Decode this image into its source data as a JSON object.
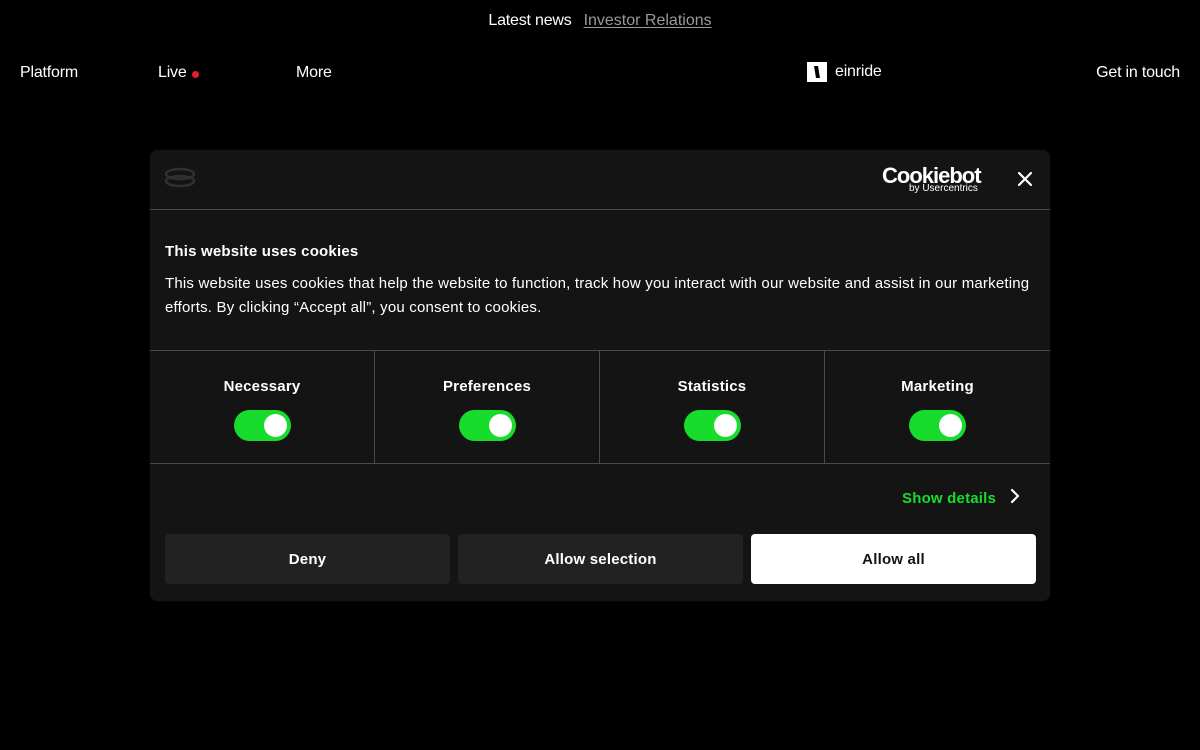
{
  "topbar": {
    "latest_news": "Latest news",
    "investor_relations": "Investor Relations"
  },
  "nav": {
    "platform": "Platform",
    "live": "Live",
    "more": "More",
    "brand": "einride",
    "get_in_touch": "Get in touch",
    "live_dot_color": "#e4202a"
  },
  "cookie_dialog": {
    "provider_name": "Cookiebot",
    "provider_sub": "by Usercentrics",
    "title": "This website uses cookies",
    "text": "This website uses cookies that help the website to function, track how you interact with our website and assist in our marketing efforts. By clicking “Accept all”, you consent to cookies.",
    "categories": [
      {
        "label": "Necessary",
        "enabled": true
      },
      {
        "label": "Preferences",
        "enabled": true
      },
      {
        "label": "Statistics",
        "enabled": true
      },
      {
        "label": "Marketing",
        "enabled": true
      }
    ],
    "show_details": "Show details",
    "buttons": {
      "deny": "Deny",
      "allow_selection": "Allow selection",
      "allow_all": "Allow all"
    },
    "accent_color": "#18dc2b"
  }
}
